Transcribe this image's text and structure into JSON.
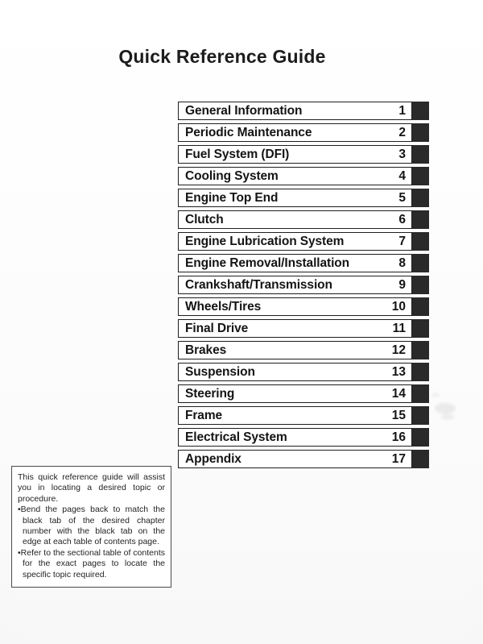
{
  "page": {
    "title": "Quick Reference Guide"
  },
  "chapters": [
    {
      "label": "General Information",
      "number": "1"
    },
    {
      "label": "Periodic Maintenance",
      "number": "2"
    },
    {
      "label": "Fuel System (DFI)",
      "number": "3"
    },
    {
      "label": "Cooling System",
      "number": "4"
    },
    {
      "label": "Engine Top End",
      "number": "5"
    },
    {
      "label": "Clutch",
      "number": "6"
    },
    {
      "label": "Engine Lubrication System",
      "number": "7"
    },
    {
      "label": "Engine Removal/Installation",
      "number": "8"
    },
    {
      "label": "Crankshaft/Transmission",
      "number": "9"
    },
    {
      "label": "Wheels/Tires",
      "number": "10"
    },
    {
      "label": "Final Drive",
      "number": "11"
    },
    {
      "label": "Brakes",
      "number": "12"
    },
    {
      "label": "Suspension",
      "number": "13"
    },
    {
      "label": "Steering",
      "number": "14"
    },
    {
      "label": "Frame",
      "number": "15"
    },
    {
      "label": "Electrical System",
      "number": "16"
    },
    {
      "label": "Appendix",
      "number": "17"
    }
  ],
  "footnote": {
    "intro": "This quick reference guide will assist you in locating a desired topic or procedure.",
    "bullet1": "•Bend the pages back to match the black tab of the desired chapter number with the black tab on the edge at each table of contents page.",
    "bullet2": "•Refer to the sectional table of contents for the exact pages to locate the specific topic required."
  },
  "colors": {
    "tab": "#2a2a2a",
    "text": "#141414",
    "border": "#1f1f1f",
    "paper": "#fdfdfd"
  }
}
